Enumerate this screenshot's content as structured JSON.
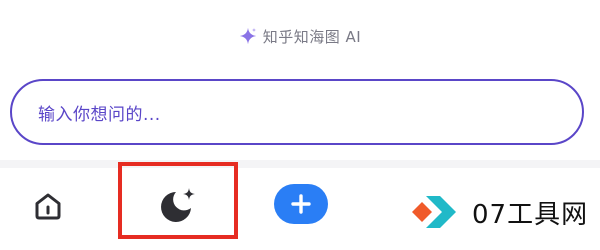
{
  "header": {
    "brand_text": "知乎知海图 AI",
    "sparkle_icon": "sparkle-icon",
    "accent_color": "#8a73e6"
  },
  "search": {
    "placeholder": "输入你想问的..."
  },
  "tabbar": {
    "home_icon": "home-icon",
    "ai_icon": "moon-sparkle-icon",
    "add_icon": "plus-icon",
    "add_button_color": "#2a7ef5",
    "highlight_color": "#e62c22"
  },
  "watermark": {
    "text": "07工具网",
    "colors": [
      "#f05a2a",
      "#20b9c8"
    ]
  }
}
